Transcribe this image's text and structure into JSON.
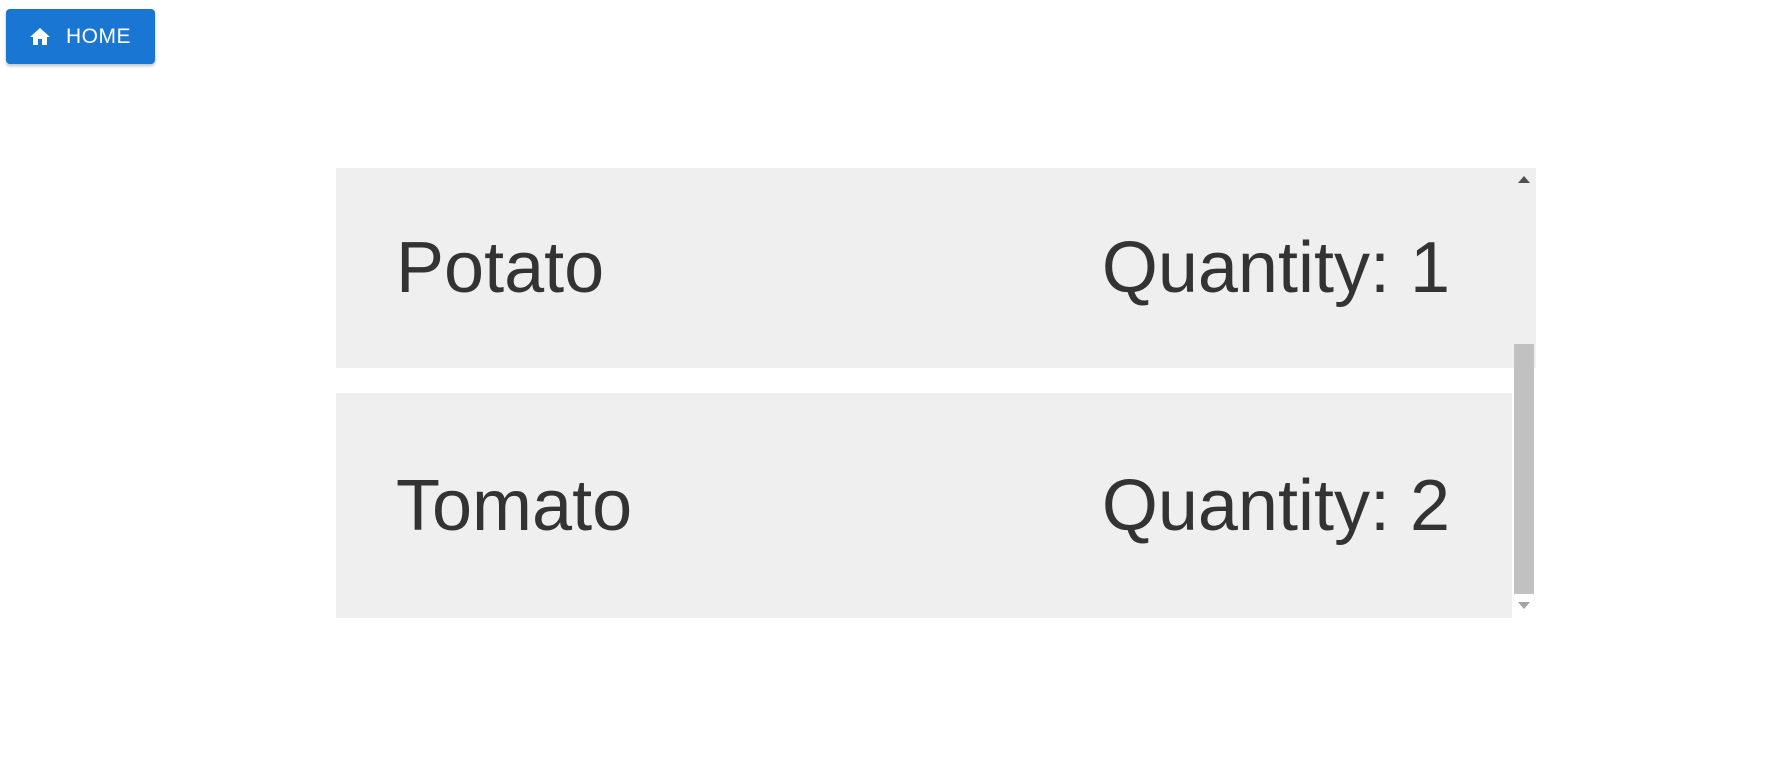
{
  "home_button": {
    "label": "HOME",
    "icon": "home-icon",
    "color": "#1976d2"
  },
  "items": [
    {
      "name": "Potato",
      "quantity_text": "Quantity: 1"
    },
    {
      "name": "Tomato",
      "quantity_text": "Quantity: 2"
    }
  ],
  "colors": {
    "item_background": "#efefef",
    "text": "#333333",
    "scroll_thumb": "#c1c1c1"
  }
}
